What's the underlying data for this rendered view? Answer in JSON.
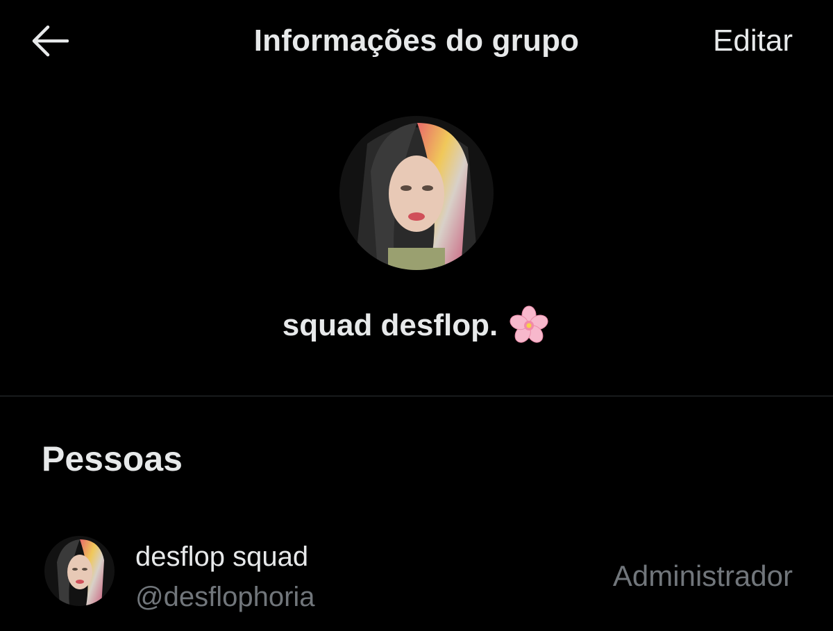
{
  "header": {
    "title": "Informações do grupo",
    "edit_label": "Editar"
  },
  "group": {
    "name": "squad desflop.",
    "emoji": "cherry-blossom-icon"
  },
  "people_section": {
    "title": "Pessoas",
    "members": [
      {
        "name": "desflop squad",
        "handle": "@desflophoria",
        "role": "Administrador"
      }
    ]
  },
  "colors": {
    "background": "#000000",
    "primary_text": "#e7e9ea",
    "secondary_text": "#71767b",
    "divider": "#2f3336"
  }
}
